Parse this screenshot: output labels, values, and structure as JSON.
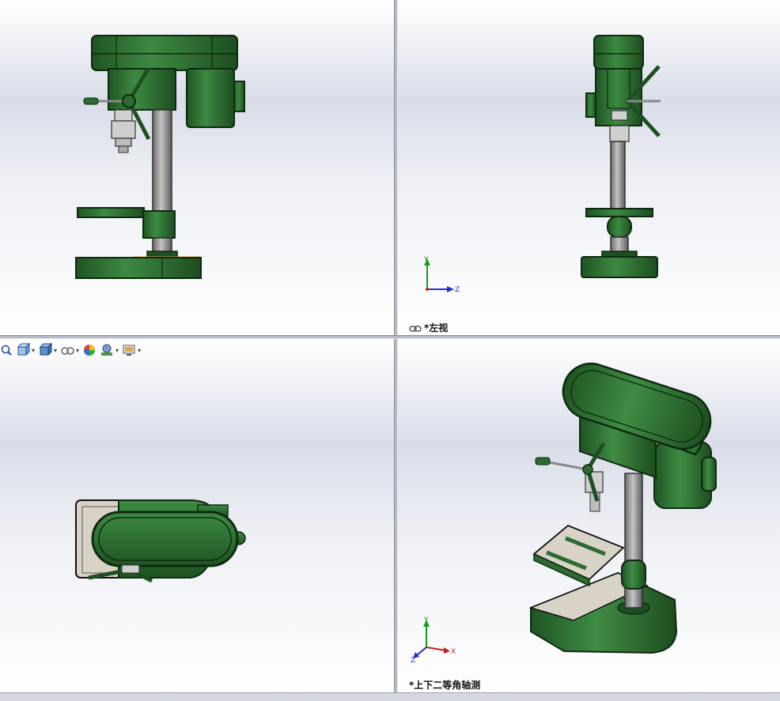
{
  "viewports": {
    "front": {
      "label": ""
    },
    "left": {
      "label": "*左视"
    },
    "top": {
      "label": ""
    },
    "iso": {
      "label": "*上下二等角轴测"
    }
  },
  "triad": {
    "y": "Y",
    "z": "Z",
    "x": "X"
  },
  "toolbar": {
    "items": [
      {
        "icon": "zoom-to-fit-icon"
      },
      {
        "icon": "view-orientation-icon"
      },
      {
        "icon": "display-style-icon"
      },
      {
        "icon": "hide-show-items-icon"
      },
      {
        "icon": "edit-appearance-icon"
      },
      {
        "icon": "apply-scene-icon"
      },
      {
        "icon": "view-settings-icon"
      }
    ]
  },
  "colors": {
    "machine_green": "#2e6b32",
    "machine_dark": "#123d15",
    "column_grey": "#8d8d8d",
    "table_beige": "#d9d3c7",
    "highlight_orange": "#e8a23a"
  }
}
